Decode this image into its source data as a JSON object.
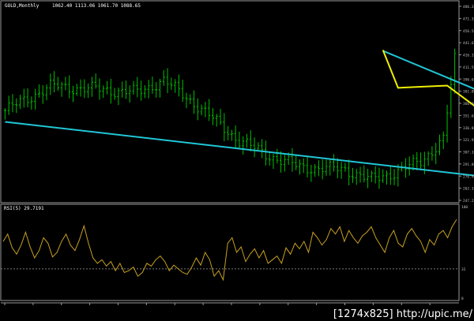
{
  "header": {
    "symbol_label": "GOLD,Monthly",
    "ohlc_label": "1062.40 1113.06 1061.70 1088.65"
  },
  "rsi_label": "RSI(5) 29.7191",
  "watermark": "[1274x825] http://upic.me/",
  "colors": {
    "background": "#000000",
    "candles": "#00c000",
    "trendlines": "#21c6d6",
    "pattern": "#f0f000",
    "targets": "#e06a2a",
    "rsi_line": "#c8a020",
    "axis_text": "#bfbfbf"
  },
  "chart_data": [
    {
      "type": "candlestick",
      "title": "GOLD,Monthly",
      "ylabel": "",
      "ylim": [
        241.0,
        498.0
      ],
      "y_ticks": [
        "486.20",
        "471.35",
        "456.50",
        "441.65",
        "426.35",
        "411.50",
        "396.65",
        "381.80",
        "366.95",
        "351.65",
        "336.80",
        "321.95",
        "307.10",
        "291.80",
        "276.95",
        "262.10",
        "247.25"
      ],
      "x_tick_count": 16,
      "y_start": 360,
      "y_end": 463,
      "annotations": [
        {
          "name": "upper-trendline",
          "color": "#21c6d6",
          "from": [
            100,
            439
          ],
          "to": [
            185,
            262
          ]
        },
        {
          "name": "lower-trendline",
          "color": "#21c6d6",
          "from": [
            0,
            345
          ],
          "to": [
            171,
            247
          ]
        },
        {
          "name": "falling-wedge-waves",
          "color": "#f0f000",
          "points": [
            [
              100,
              440
            ],
            [
              104,
              390
            ],
            [
              117,
              393
            ],
            [
              142,
              300
            ],
            [
              157,
              308
            ],
            [
              165,
              258
            ],
            [
              169,
              337
            ]
          ]
        },
        {
          "name": "orange-targets",
          "color": "#e06a2a",
          "points": [
            [
              145,
              345
            ],
            [
              165,
              340
            ]
          ]
        }
      ]
    },
    {
      "type": "line",
      "title": "RSI(5) 29.7191",
      "ylim": [
        0,
        100
      ],
      "y_ticks": [
        "100",
        "32",
        "0"
      ],
      "levels": [
        32
      ],
      "values": [
        62,
        70,
        55,
        48,
        58,
        72,
        56,
        44,
        52,
        66,
        60,
        45,
        50,
        62,
        70,
        58,
        52,
        64,
        79,
        60,
        44,
        38,
        42,
        35,
        40,
        30,
        38,
        28,
        30,
        34,
        24,
        28,
        38,
        35,
        42,
        46,
        40,
        30,
        36,
        32,
        28,
        26,
        34,
        44,
        36,
        50,
        42,
        24,
        30,
        20,
        60,
        66,
        50,
        56,
        40,
        48,
        54,
        44,
        52,
        38,
        42,
        46,
        38,
        55,
        48,
        60,
        54,
        62,
        50,
        72,
        66,
        58,
        64,
        76,
        70,
        78,
        62,
        74,
        66,
        60,
        68,
        72,
        78,
        66,
        58,
        50,
        66,
        74,
        60,
        56,
        70,
        76,
        68,
        62,
        50,
        64,
        58,
        70,
        74,
        66,
        78,
        86
      ]
    }
  ]
}
